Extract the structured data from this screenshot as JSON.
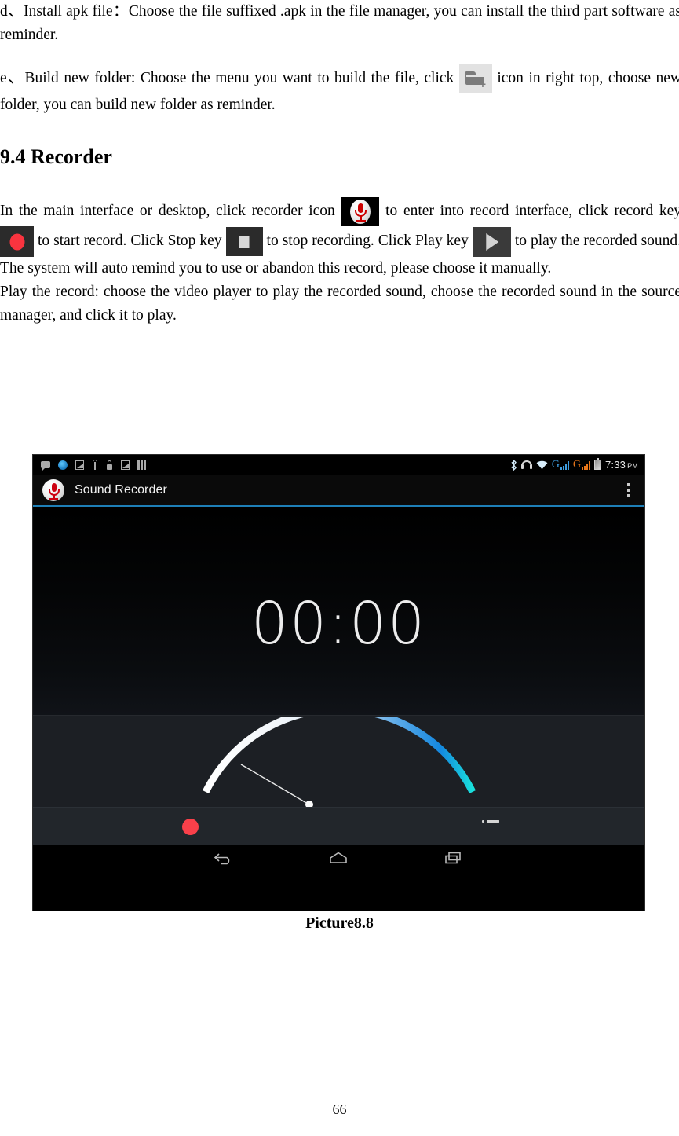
{
  "document": {
    "paragraphs": {
      "install_apk": "d、Install apk file：Choose the file suffixed .apk in the file manager, you can install the third part software as reminder.",
      "build_folder_pre": "e、Build new folder: Choose the menu you want to build the file, click",
      "build_folder_post": "icon in right top, choose new folder, you can build new folder as reminder.",
      "heading_recorder": "9.4 Recorder",
      "recorder_line1_pre": "In the main interface or desktop, click recorder icon",
      "recorder_line1_mid": "to enter into record interface, click record key",
      "recorder_line1_b": "to start record. Click Stop key",
      "recorder_line1_c": "to stop recording. Click Play key",
      "recorder_line2": "to play the recorded sound. The system will auto remind you to use or abandon this record, please choose it manually.",
      "recorder_line3": "Play the record: choose the video player to play the recorded sound, choose the recorded sound in the source manager, and click it to play."
    },
    "inline_icons": {
      "new_folder": "new-folder-icon",
      "recorder_app": "sound-recorder-app-icon",
      "record_key": "record-key-icon",
      "stop_key": "stop-key-icon",
      "play_key": "play-key-icon"
    },
    "figure_caption": "Picture8.8",
    "page_number": "66"
  },
  "screenshot": {
    "status_bar": {
      "left_icons": [
        "sms-message-icon",
        "browser-icon",
        "screenshot-icon",
        "usb-icon",
        "lock-icon",
        "image-icon",
        "sdcard-icon"
      ],
      "right_icons": [
        "bluetooth-icon",
        "headset-icon",
        "wifi-icon",
        "mobile-signal-g-blue-icon",
        "mobile-signal-g-orange-icon",
        "battery-icon"
      ],
      "signal_label_sim1": "G",
      "signal_label_sim2": "G",
      "clock_time": "7:33",
      "clock_ampm": "PM"
    },
    "action_bar": {
      "app_icon": "sound-recorder-icon",
      "title": "Sound Recorder",
      "overflow": "overflow-menu-icon",
      "accent_color": "#1e7fb7"
    },
    "recorder": {
      "timer": "00:00",
      "vu_meter": "vu-meter-gauge",
      "record_button": "record-button",
      "record_button_color": "#f9404a",
      "list_button": "recordings-list-button"
    },
    "nav_bar": {
      "back": "back-icon",
      "home": "home-icon",
      "recents": "recent-apps-icon"
    }
  }
}
